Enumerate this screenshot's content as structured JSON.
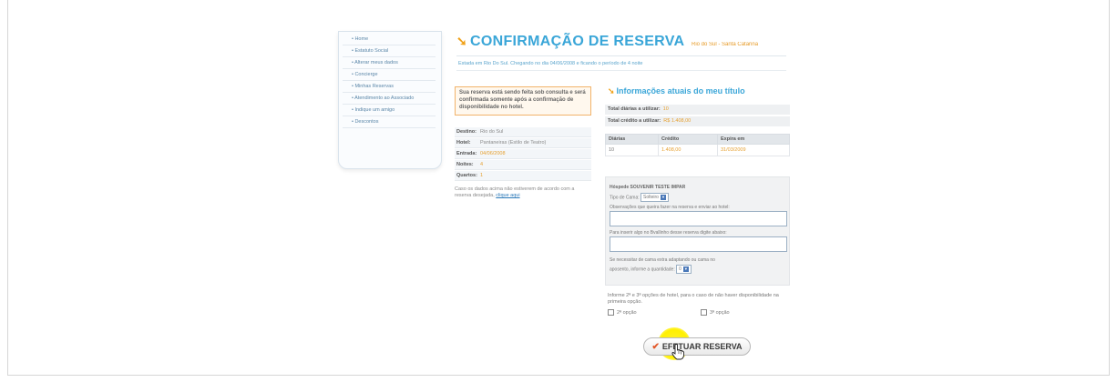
{
  "sidebar": {
    "items": [
      "• Home",
      "• Estatuto Social",
      "• Alterar meus dados",
      "• Concierge",
      "• Minhas Reservas",
      "• Atendimento ao Associado",
      "• Indique um amigo",
      "• Descontos"
    ]
  },
  "header": {
    "title": "CONFIRMAÇÃO DE RESERVA",
    "location": "Rio do Sul - Santa Catarina",
    "subtitle": "Estada em Rio Do Sul. Chegando no dia 04/06/2008 e ficando o período de 4 noite"
  },
  "notice": "Sua reserva está sendo feita sob consulta e será confirmada somente após a confirmação de disponibilidade no hotel.",
  "details": {
    "rows": [
      {
        "k": "Destino:",
        "v": "Rio do Sul"
      },
      {
        "k": "Hotel:",
        "v": "Pantaneiras (Estilo de Teatro)"
      },
      {
        "k": "Entrada:",
        "v": "04/06/2008"
      },
      {
        "k": "Noites:",
        "v": "4"
      },
      {
        "k": "Quartos:",
        "v": "1"
      }
    ],
    "note": "Caso os dados acima não estiverem de acordo com a reserva desejada,",
    "note_link": "clique aqui"
  },
  "info": {
    "title": "Informações atuais do meu título",
    "diarias_label": "Total diárias a utilizar:",
    "diarias_value": "10",
    "credito_label": "Total crédito a utilizar:",
    "credito_value": "R$ 1.408,00",
    "table_headers": [
      "Diárias",
      "Crédito",
      "Expira em"
    ],
    "table_rows": [
      [
        "10",
        "1.408,00",
        "31/03/2009"
      ]
    ]
  },
  "form": {
    "guest_label": "Hóspede SOUVENIR TESTE IMPAR",
    "bed_type_label": "Tipo de Cama:",
    "bed_type_value": "Solteiro",
    "obs_label": "Observações que queira fazer na reserva e enviar ao hotel:",
    "extra_label": "Para inserir algo no Bvallinho desse reserva digite abaixo:",
    "adj_label": "Se necessitar de cama extra adaptando ou cama no",
    "adj_label2": "aposento, informe a quantidade:",
    "adj_value": "0"
  },
  "options": {
    "text": "Informe 2ª e 3ª opções de hotel, para o caso de não haver disponibilidade na primeira opção.",
    "opt2": "2ª opção",
    "opt3": "3ª opção"
  },
  "button": {
    "label": "EFETUAR RESERVA"
  }
}
